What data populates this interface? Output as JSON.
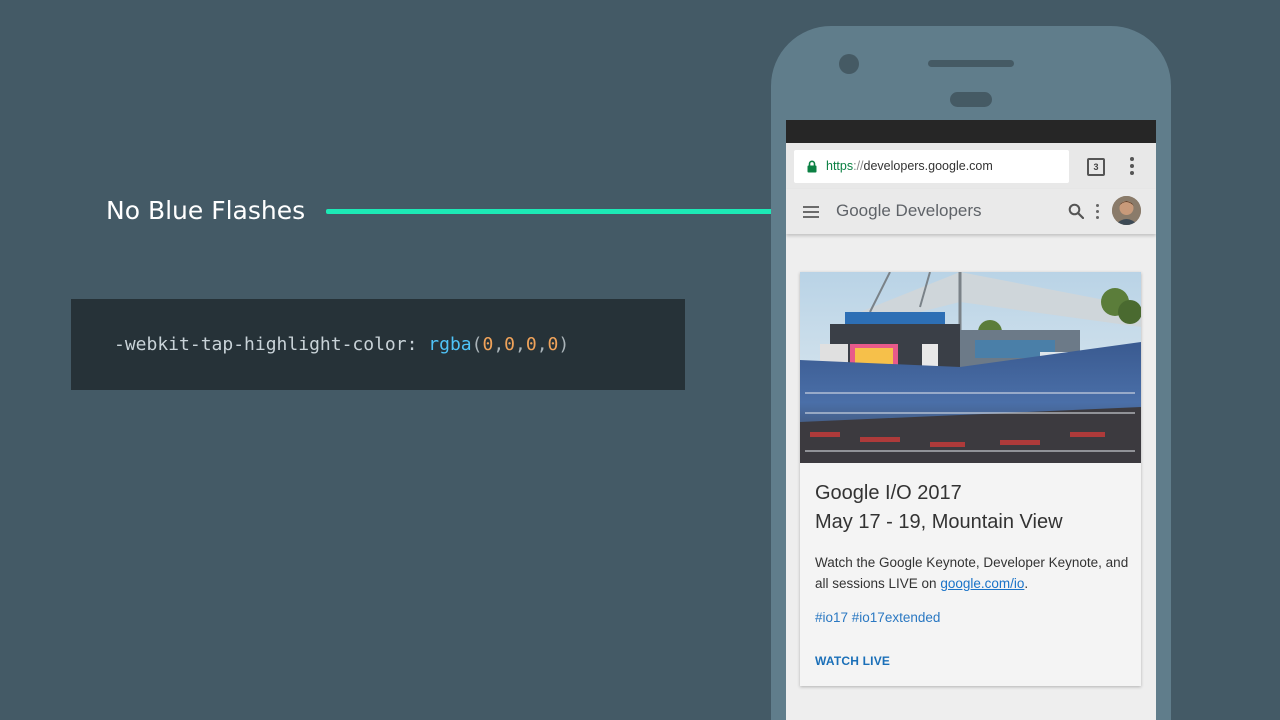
{
  "callout": {
    "label": "No Blue Flashes",
    "accent_color": "#1de9b6"
  },
  "code": {
    "property": "-webkit-tap-highlight-color: ",
    "func": "rgba",
    "open_paren": "(",
    "args": [
      "0",
      "0",
      "0",
      "0"
    ],
    "comma": ",",
    "close_paren": ")"
  },
  "browser": {
    "url_scheme": "https",
    "url_separator": "://",
    "url_host": "developers.google.com",
    "tab_count": "3",
    "lock_icon": "lock-icon",
    "menu_icon": "more-vert-icon"
  },
  "site": {
    "title": "Google Developers",
    "menu_icon": "hamburger-icon",
    "search_icon": "search-icon",
    "more_icon": "more-vert-icon"
  },
  "card": {
    "title_line1": "Google I/O 2017",
    "title_line2": "May 17 - 19, Mountain View",
    "body_text": "Watch the Google Keynote, Developer Keynote, and all sessions LIVE on ",
    "body_link": "google.com/io",
    "body_end": ".",
    "tags": "#io17 #io17extended",
    "action": "WATCH LIVE"
  },
  "colors": {
    "background": "#445a66",
    "phone_body": "#607d8b",
    "code_background": "#263238",
    "link_blue": "#1a73c8"
  }
}
